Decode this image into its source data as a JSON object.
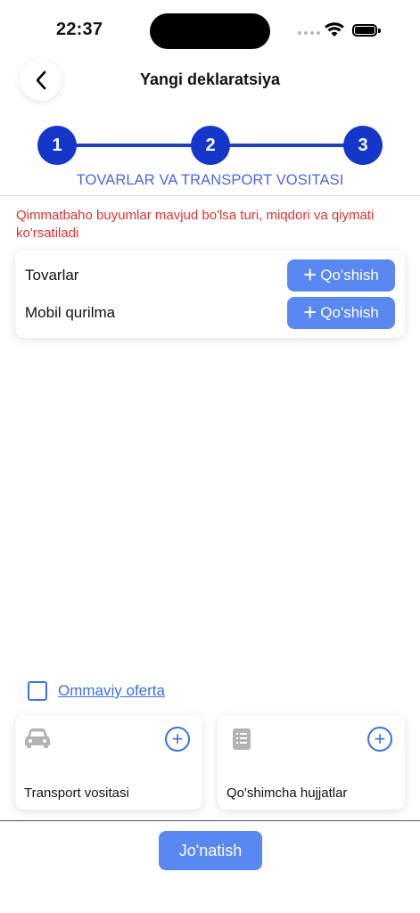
{
  "status_bar": {
    "time": "22:37"
  },
  "header": {
    "title": "Yangi deklaratsiya"
  },
  "stepper": {
    "steps": [
      "1",
      "2",
      "3"
    ],
    "current_title": "TOVARLAR VA TRANSPORT VOSITASI"
  },
  "notice": {
    "text": "Qimmatbaho buyumlar mavjud bo'lsa turi, miqdori va qiymati ko'rsatiladi"
  },
  "goods": {
    "rows": [
      {
        "label": "Tovarlar",
        "button": "Qo'shish"
      },
      {
        "label": "Mobil qurilma",
        "button": "Qo'shish"
      }
    ]
  },
  "offer": {
    "link": "Ommaviy oferta",
    "checked": false
  },
  "cards": [
    {
      "label": "Transport vositasi",
      "icon": "car-icon"
    },
    {
      "label": "Qo'shimcha hujjatlar",
      "icon": "document-icon"
    }
  ],
  "footer": {
    "submit": "Jo'natish"
  },
  "colors": {
    "accent": "#5a88f2",
    "step": "#1537c9",
    "warning": "#e0312f",
    "link": "#3a6fe8"
  }
}
